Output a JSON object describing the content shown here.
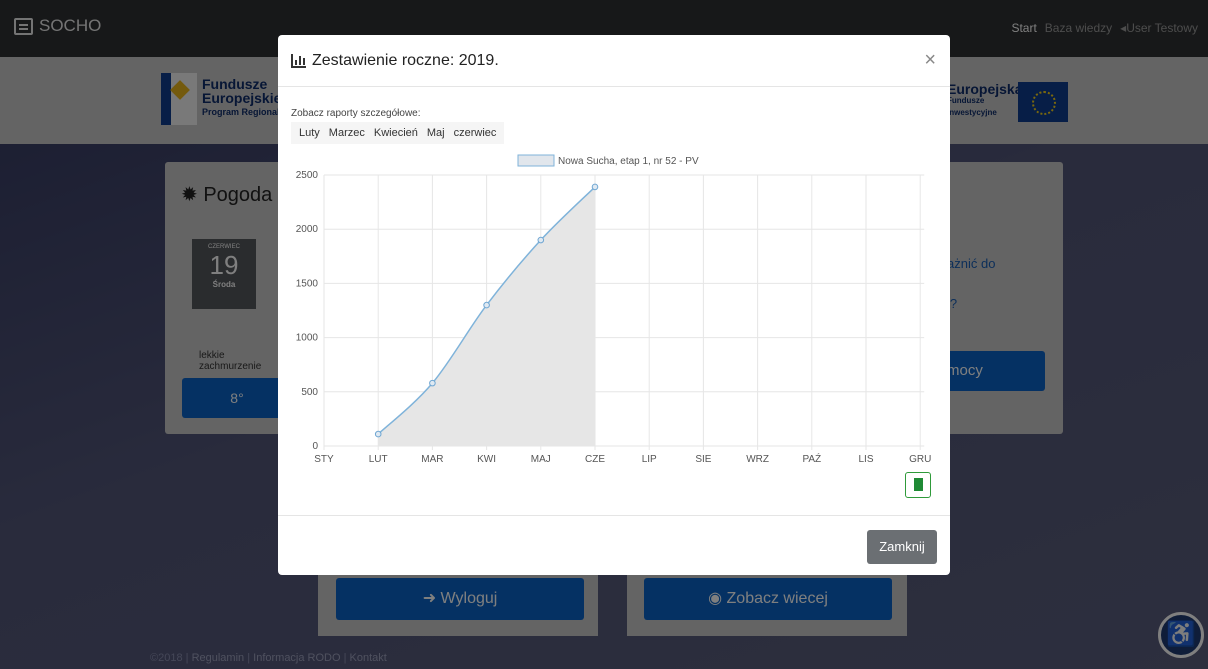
{
  "navbar": {
    "brand": "SOCHO",
    "start": "Start",
    "knowledge": "Baza wiedzy",
    "user": "User Testowy"
  },
  "banner": {
    "fe_line1": "Fundusze",
    "fe_line2": "Europejskie",
    "fe_line3": "Program Regionalny",
    "ue_line1": "Europejska",
    "ue_line2": "Fundusze",
    "ue_line3": "Inwestycyjne"
  },
  "weather": {
    "title": "Pogoda",
    "month": "CZERWIEC",
    "day": "19",
    "weekday": "Środa",
    "desc": "lekkie zachmurzenie",
    "temp": "8°"
  },
  "side": {
    "link1": "ażnić do",
    "link2": "i?",
    "help": "mocy"
  },
  "bottom": {
    "logout": "Wyloguj",
    "more": "Zobacz wiecej"
  },
  "footer": {
    "copy": "©2018",
    "regulamin": "Regulamin",
    "rodo": "Informacja RODO",
    "kontakt": "Kontakt"
  },
  "modal": {
    "title": "Zestawienie roczne: 2019.",
    "reports_label": "Zobacz raporty szczegółowe:",
    "months": [
      "Luty",
      "Marzec",
      "Kwiecień",
      "Maj",
      "czerwiec"
    ],
    "close_label": "Zamknij"
  },
  "chart_data": {
    "type": "area",
    "categories": [
      "STY",
      "LUT",
      "MAR",
      "KWI",
      "MAJ",
      "CZE",
      "LIP",
      "SIE",
      "WRZ",
      "PAŹ",
      "LIS",
      "GRU"
    ],
    "series": [
      {
        "name": "Nowa Sucha, etap 1, nr 52 - PV",
        "values": [
          null,
          110,
          580,
          1300,
          1900,
          2390,
          null,
          null,
          null,
          null,
          null,
          null
        ]
      }
    ],
    "ylim": [
      0,
      2500
    ],
    "yticks": [
      0,
      500,
      1000,
      1500,
      2000,
      2500
    ],
    "grid": true,
    "legend": "top",
    "colors": {
      "line": "#7fb3da",
      "fill": "#e6e6e6",
      "point": "#6fa6d2"
    }
  }
}
